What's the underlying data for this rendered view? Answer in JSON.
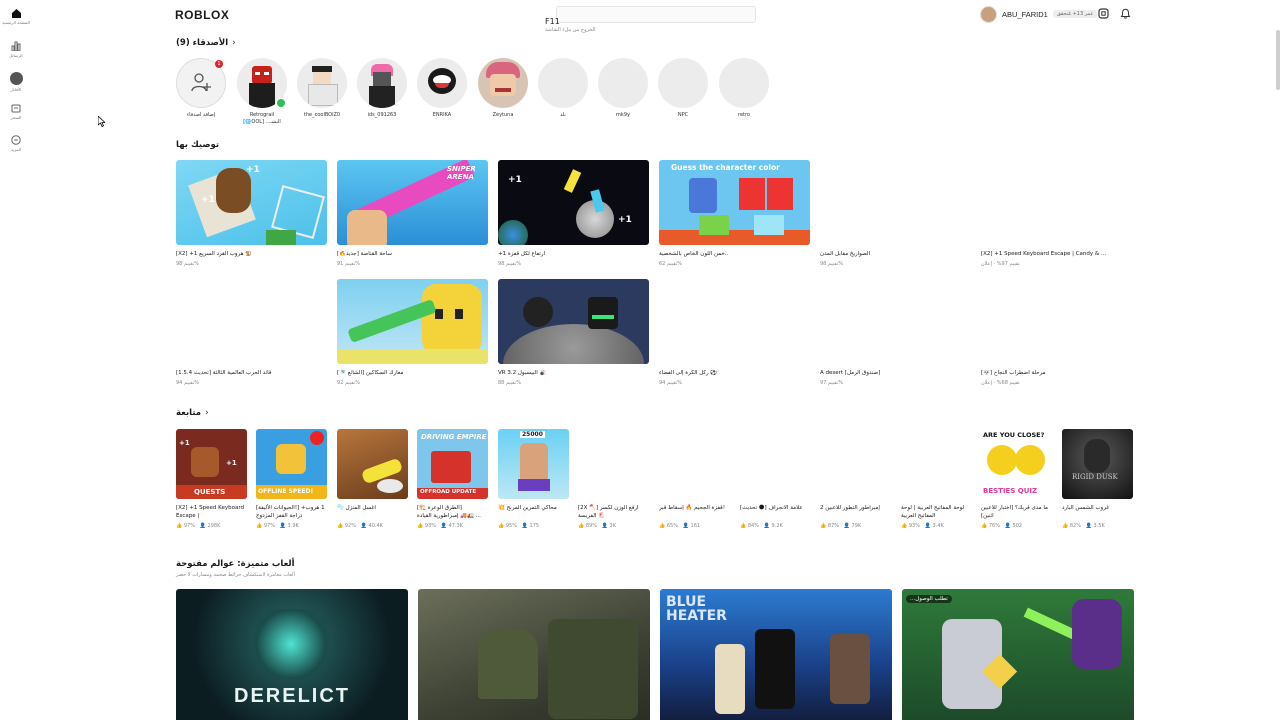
{
  "rail": {
    "items": [
      {
        "label": "الصفحة الرئيسية",
        "icon": "home-icon"
      },
      {
        "label": "الرسائل",
        "icon": "charts-icon"
      },
      {
        "label": "الأفاتار",
        "icon": "avatar-icon"
      },
      {
        "label": "المتجر",
        "icon": "marketplace-icon"
      },
      {
        "label": "المزيد",
        "icon": "more-icon"
      }
    ]
  },
  "header": {
    "logo": "ROBLOX",
    "search_key": "F11",
    "search_hint": "الخروج من ملء الشاشة",
    "username": "ABU_FARID1",
    "age_badge": "عمر 13+ مُتحقق"
  },
  "friends": {
    "title": "الأصدقاء (9)",
    "add_label": "إضافة أصدقاء",
    "notif_count": "1",
    "list": [
      "إضافة أصدقاء",
      "Retrograil",
      "the_coolBOiZ0",
      "ids_091263",
      "ENRIKA",
      "Zeytuna",
      "بلد",
      "mk9y",
      "NPC",
      "retro"
    ],
    "retrograil_sub": "[🌐OOL] ...النشـ"
  },
  "recommended": {
    "title": "توصيك بها",
    "games": [
      {
        "title": "[X2] +1 هروب القرد السريع 🐒",
        "stats": "تقييم 98%"
      },
      {
        "title": "[🔥جديد] ساحة القناصة",
        "stats": "تقييم 91%"
      },
      {
        "title": "+1 ارتفاع لكل قفزة",
        "stats": "تقييم 98%"
      },
      {
        "title": "خمن اللون الخاص بالشخصية..",
        "stats": "تقييم 62%"
      },
      {
        "title": "الصواريخ مقابل المدن",
        "stats": "تقييم 98%"
      },
      {
        "title": "[X2] +1 Speed Keyboard Escape | Candy & ...",
        "stats": "تقييم 97% · إعلان"
      },
      {
        "title": "[تحديث 1.5.4] قائد الحرب العالمية الثالثة",
        "stats": "تقييم 94%"
      },
      {
        "title": "[🚿 الشائع] معارك السكاكين",
        "stats": "تقييم 92%"
      },
      {
        "title": "VR البيسبول 3.2 🎳",
        "stats": "تقييم 88%"
      },
      {
        "title": "ركل الكرة إلى الفضاء ⚽",
        "stats": "تقييم 94%"
      },
      {
        "title": "A desert [صندوق الرمل]",
        "stats": "تقييم 97%"
      },
      {
        "title": "[💀] مرحلة اضطراب النجاح",
        "stats": "تقييم 68% · إعلان"
      }
    ]
  },
  "continue": {
    "title": "متابعة",
    "games": [
      {
        "title": "[X2] +1 Speed Keyboard Escape |",
        "rating": "97%",
        "players": "298K"
      },
      {
        "title": "[الحيوانات الأليفة!] +1 هروب دراجة القفز المزدوج",
        "rating": "97%",
        "players": "3.9K"
      },
      {
        "title": "🫧 اغسل المنزل",
        "rating": "92%",
        "players": "40.4K"
      },
      {
        "title": "[🏗️ الطرق الوعرة] إمبراطورية القيادة 🚚🚛 ...",
        "rating": "93%",
        "players": "47.3K"
      },
      {
        "title": "💥 محاكي التمرين المربح",
        "rating": "95%",
        "players": "175"
      },
      {
        "title": "[2X 🪓] ارفع الوزن لكسر الفريسة 🐔",
        "rating": "89%",
        "players": "3K"
      },
      {
        "title": "قفزة الجحيم 🔥 إسقاط قبر!",
        "rating": "65%",
        "players": "161"
      },
      {
        "title": "[تحديث 🌑] علامة الانجراف",
        "rating": "84%",
        "players": "9.2K"
      },
      {
        "title": "إمبراطور التطور للاعبين 2",
        "rating": "87%",
        "players": "79K"
      },
      {
        "title": "لوحة المفاتيح العربية | لوحة المفاتيح العربية",
        "rating": "93%",
        "players": "3.4K"
      },
      {
        "title": "ما مدى قربك؟ [اختبار للاعبين اثنين]",
        "rating": "76%",
        "players": "502"
      },
      {
        "title": "غروب الشمس البارد",
        "rating": "82%",
        "players": "3.5K"
      }
    ],
    "thumb_text": {
      "quests": "QUESTS",
      "offline": "OFFLINE SPEED!",
      "driving": "DRIVING EMPIRE",
      "offroad": "OFFROAD UPDATE",
      "besties_q": "ARE YOU CLOSE?",
      "besties": "BESTIES QUIZ",
      "num": "25000",
      "rigid": "RIGID DUSK"
    }
  },
  "featured": {
    "title": "ألعاب متميزة: عوالم مفتوحة",
    "subtitle": "ألعاب مغامرة لاستكشاف خرائط ضخمة ومسارات لا حصر",
    "derelict": "DERELICT",
    "blue_heater": "BLUE HEATER",
    "tag": "...تطلب الوصول"
  },
  "colors": {
    "accent": "#e0222b",
    "online": "#2dbf5a",
    "placeholder": "#ececec"
  }
}
